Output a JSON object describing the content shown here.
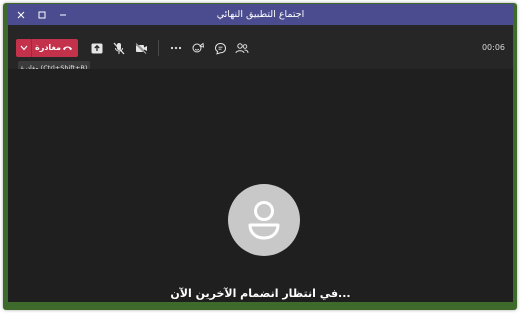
{
  "window": {
    "title": "اجتماع التطبيق النهائي",
    "controls": {
      "close_icon": "close-icon",
      "maximize_icon": "maximize-icon",
      "minimize_icon": "minimize-icon"
    }
  },
  "toolbar": {
    "leave_label": "مغادرة",
    "leave_tooltip": "مغادرة (Ctrl+Shift+B)",
    "timer": "00:06",
    "icons": [
      "share-icon",
      "mic-off-icon",
      "camera-off-icon",
      "more-icon",
      "reactions-icon",
      "chat-icon",
      "participants-icon"
    ]
  },
  "stage": {
    "waiting_text": "في انتظار انضمام الآخرين الآن..."
  },
  "colors": {
    "titlebar": "#4b4c8f",
    "leave": "#c4314b",
    "background": "#1f1f1f",
    "frame": "#3e6a2c"
  }
}
